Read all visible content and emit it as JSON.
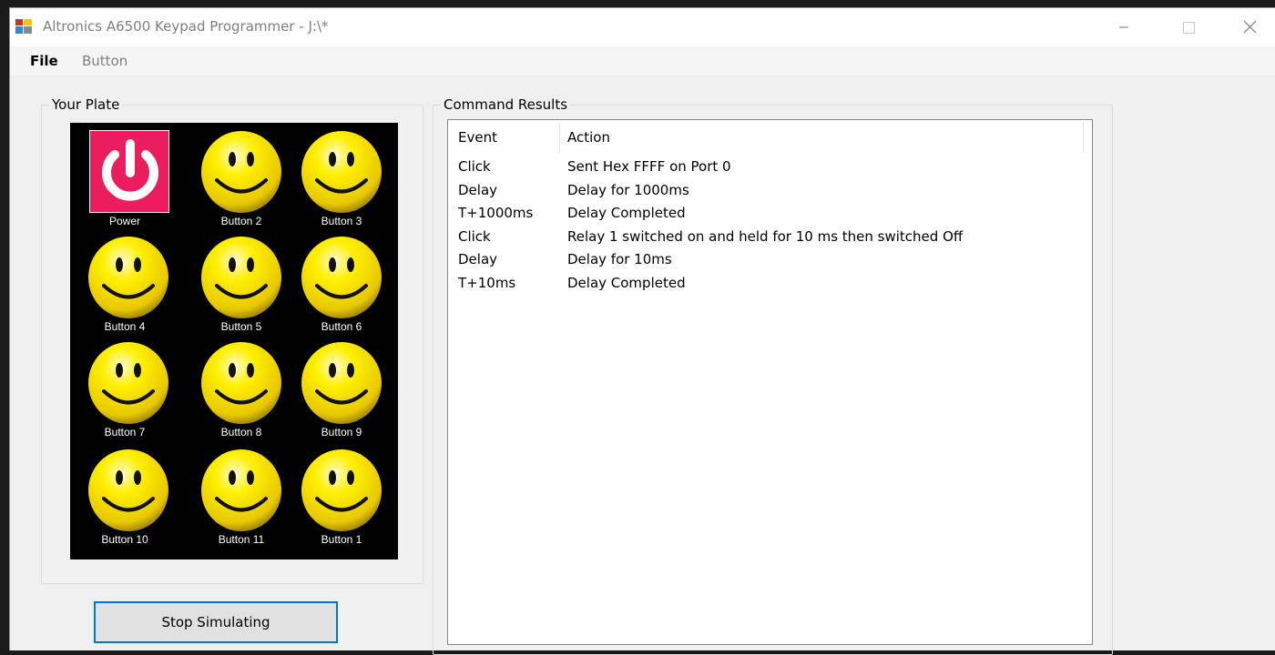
{
  "window": {
    "title": "Altronics A6500 Keypad Programmer - J:\\*"
  },
  "menu": {
    "file": "File",
    "button": "Button"
  },
  "plate": {
    "group_label": "Your Plate",
    "keys": [
      {
        "label": "Power",
        "icon": "power-icon"
      },
      {
        "label": "Button 2",
        "icon": "smiley-icon"
      },
      {
        "label": "Button 3",
        "icon": "smiley-icon"
      },
      {
        "label": "Button 4",
        "icon": "smiley-icon"
      },
      {
        "label": "Button 5",
        "icon": "smiley-icon"
      },
      {
        "label": "Button 6",
        "icon": "smiley-icon"
      },
      {
        "label": "Button 7",
        "icon": "smiley-icon"
      },
      {
        "label": "Button 8",
        "icon": "smiley-icon"
      },
      {
        "label": "Button 9",
        "icon": "smiley-icon"
      },
      {
        "label": "Button 10",
        "icon": "smiley-icon"
      },
      {
        "label": "Button 11",
        "icon": "smiley-icon"
      },
      {
        "label": "Button 1",
        "icon": "smiley-icon"
      }
    ]
  },
  "stop_button_label": "Stop Simulating",
  "results": {
    "group_label": "Command Results",
    "columns": [
      "Event",
      "Action"
    ],
    "rows": [
      {
        "event": "Click",
        "action": "Sent Hex FFFF on Port 0"
      },
      {
        "event": "Delay",
        "action": "Delay for 1000ms"
      },
      {
        "event": "T+1000ms",
        "action": "Delay Completed"
      },
      {
        "event": "Click",
        "action": "Relay 1 switched on and held for 10 ms then switched Off"
      },
      {
        "event": "Delay",
        "action": "Delay for 10ms"
      },
      {
        "event": "T+10ms",
        "action": "Delay Completed"
      }
    ]
  },
  "colors": {
    "power_background": "#ea1d5d",
    "smiley_yellow": "#f5e100",
    "focus_blue": "#0078d7"
  }
}
